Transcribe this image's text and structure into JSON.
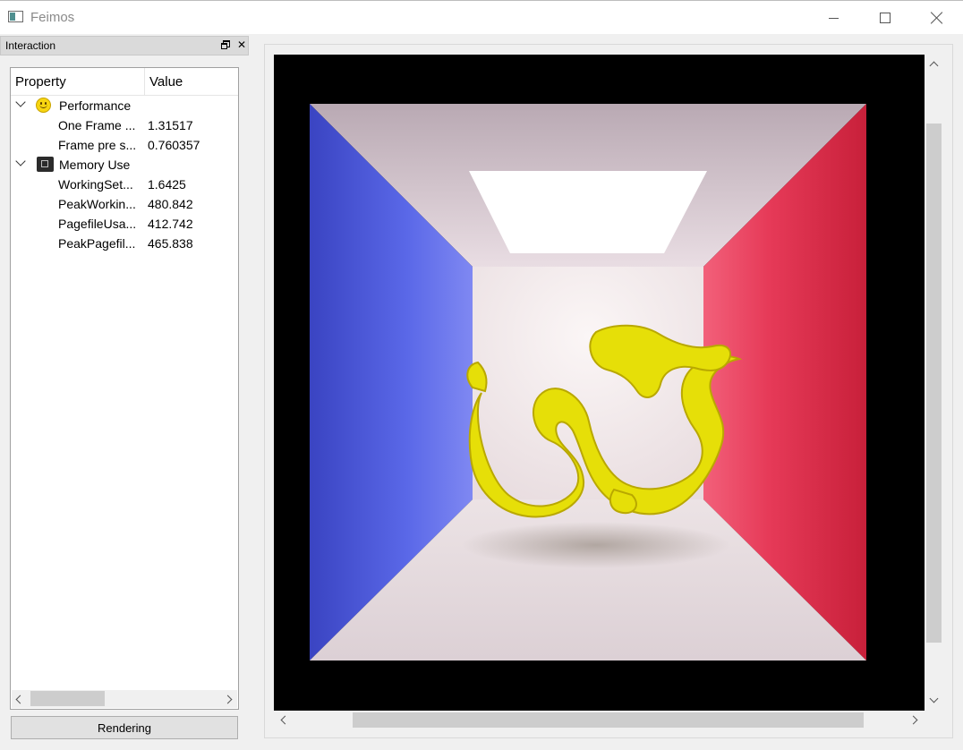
{
  "window": {
    "title": "Feimos",
    "icons": {
      "app": "app-window-icon",
      "minimize": "minimize-icon",
      "maximize": "maximize-icon",
      "close": "close-icon"
    }
  },
  "dock": {
    "title": "Interaction",
    "icons": {
      "float": "dock-float-icon",
      "close": "dock-close-icon"
    },
    "close_glyph": "✕"
  },
  "tree": {
    "headers": {
      "property": "Property",
      "value": "Value"
    },
    "groups": [
      {
        "label": "Performance",
        "icon": "smiley-icon",
        "items": [
          {
            "name": "One Frame ...",
            "value": "1.31517"
          },
          {
            "name": "Frame pre s...",
            "value": "0.760357"
          }
        ]
      },
      {
        "label": "Memory Use",
        "icon": "memory-chip-icon",
        "items": [
          {
            "name": "WorkingSet...",
            "value": "1.6425"
          },
          {
            "name": "PeakWorkin...",
            "value": "480.842"
          },
          {
            "name": "PagefileUsa...",
            "value": "412.742"
          },
          {
            "name": "PeakPagefil...",
            "value": "465.838"
          }
        ]
      }
    ]
  },
  "rendering_button": "Rendering",
  "render_view": {
    "scene": "cornell-box-yellow-dragon",
    "colors": {
      "left_wall": "#4650d8",
      "right_wall": "#e0304a",
      "back_wall": "#f2ecec",
      "dragon": "#e8e000",
      "light": "#ffffff"
    }
  }
}
